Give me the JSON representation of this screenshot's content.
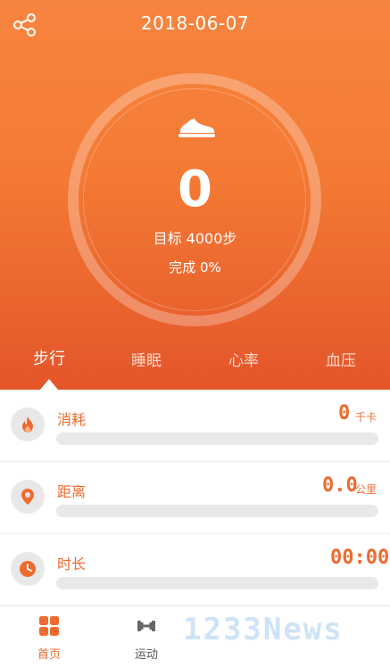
{
  "header": {
    "date": "2018-06-07"
  },
  "hero": {
    "steps": "0",
    "goal": "目标 4000步",
    "completion": "完成 0%"
  },
  "tabs": [
    "步行",
    "睡眠",
    "心率",
    "血压"
  ],
  "metrics": [
    {
      "label": "消耗",
      "value": "0",
      "unit": "千卡",
      "icon": "flame-icon",
      "progress": 0
    },
    {
      "label": "距离",
      "value": "0.0",
      "unit": "公里",
      "icon": "location-pin-icon",
      "progress": 0
    },
    {
      "label": "时长",
      "value": "00:00",
      "unit": "",
      "icon": "clock-icon",
      "progress": 0
    }
  ],
  "bottom_nav": [
    {
      "label": "首页",
      "icon": "home-grid-icon",
      "active": true
    },
    {
      "label": "运动",
      "icon": "dumbbell-icon",
      "active": false
    }
  ],
  "watermark": "1233News",
  "colors": {
    "accent": "#ef6a2e",
    "hero_top": "#f6853f",
    "hero_bottom": "#e4552a"
  }
}
